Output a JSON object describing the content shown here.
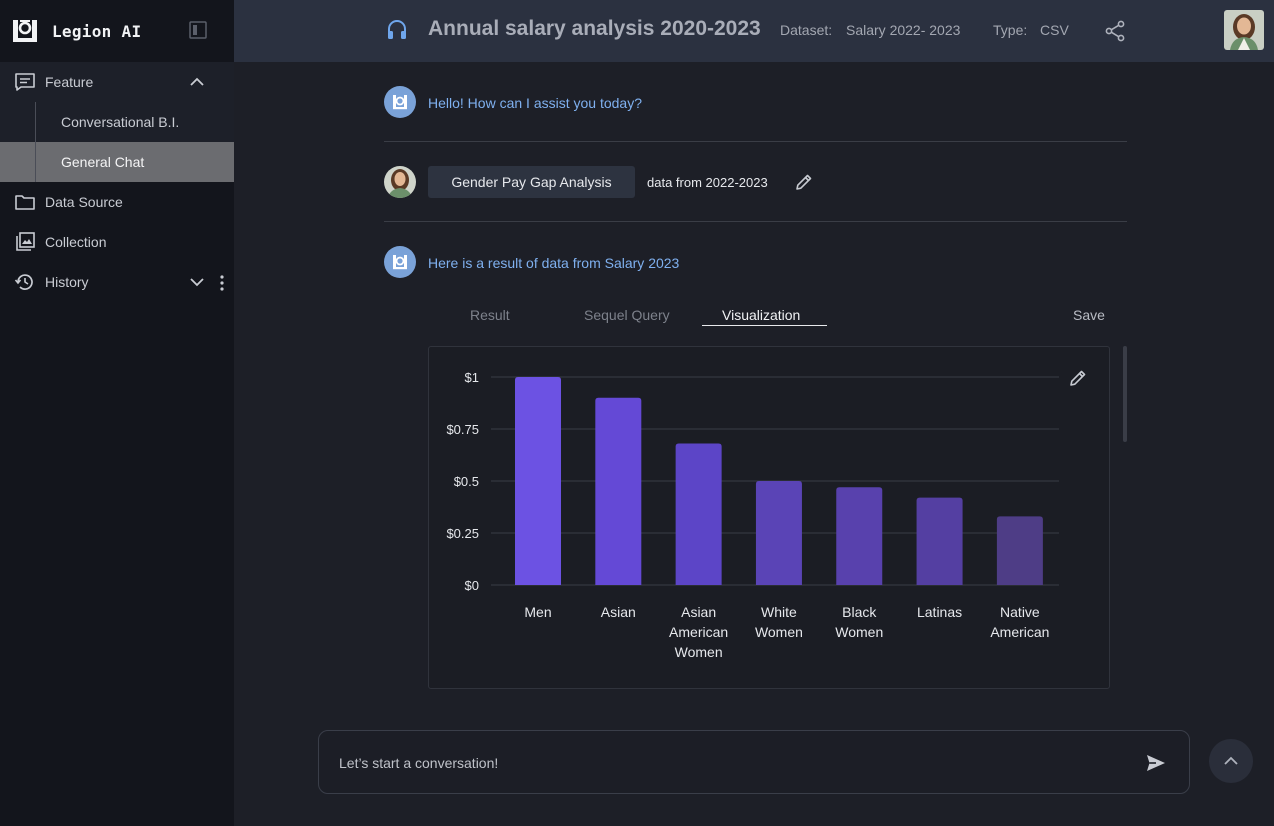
{
  "app": {
    "name": "Legion AI"
  },
  "sidebar": {
    "feature_label": "Feature",
    "sub_items": [
      "Conversational B.I.",
      "General Chat"
    ],
    "active_sub_item": "General Chat",
    "data_source_label": "Data Source",
    "collection_label": "Collection",
    "history_label": "History"
  },
  "header": {
    "title": "Annual salary analysis 2020-2023",
    "dataset_label": "Dataset:",
    "dataset_value": "Salary 2022- 2023",
    "type_label": "Type:",
    "type_value": "CSV"
  },
  "chat": {
    "greeting": "Hello! How can I assist you today?",
    "user_chip": "Gender Pay Gap Analysis",
    "user_note": "data from 2022-2023",
    "result_intro": "Here is a result of data from Salary 2023"
  },
  "tabs": {
    "items": [
      "Result",
      "Sequel Query",
      "Visualization"
    ],
    "active": "Visualization",
    "save_label": "Save"
  },
  "chart_data": {
    "type": "bar",
    "categories": [
      "Men",
      "Asian",
      "Asian American Women",
      "White Women",
      "Black Women",
      "Latinas",
      "Native American"
    ],
    "values": [
      1.0,
      0.9,
      0.68,
      0.5,
      0.47,
      0.42,
      0.33
    ],
    "y_ticks": [
      "$0",
      "$0.25",
      "$0.5",
      "$0.75",
      "$1"
    ],
    "ylim": [
      0,
      1
    ],
    "grid": true,
    "bar_colors": [
      "#6c52e3",
      "#6449d6",
      "#5c45c7",
      "#5a44b6",
      "#5841ad",
      "#543fa2",
      "#4e3d86"
    ]
  },
  "input": {
    "placeholder": "Let’s start a conversation!"
  },
  "colors": {
    "accent": "#7fb0ef",
    "sidebar_bg": "#13151c",
    "header_bg": "#2b3140"
  }
}
